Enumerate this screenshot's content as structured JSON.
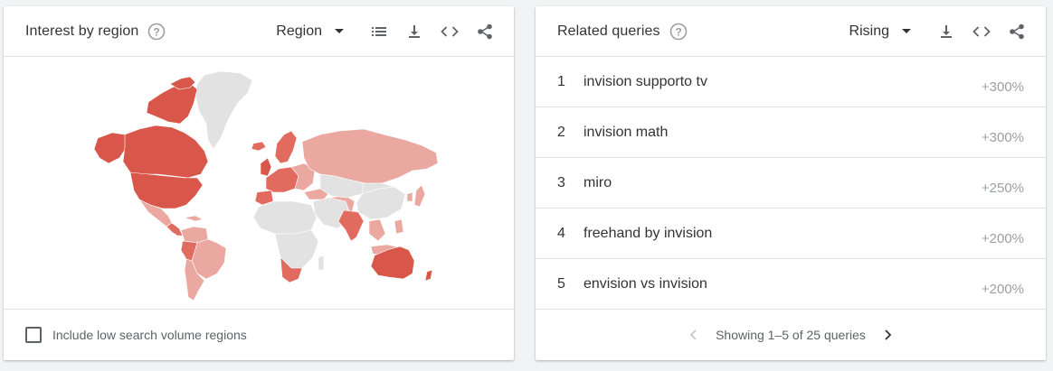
{
  "interest_card": {
    "title": "Interest by region",
    "help_icon": "help-circle-icon",
    "select_label": "Region",
    "tools": [
      "list-icon",
      "download-icon",
      "embed-code-icon",
      "share-icon"
    ],
    "checkbox_label": "Include low search volume regions",
    "checkbox_checked": false,
    "colors": {
      "high": "#d8574a",
      "medium": "#e06b5e",
      "low": "#eba8a0",
      "none": "#e2e2e2"
    }
  },
  "queries_card": {
    "title": "Related queries",
    "help_icon": "help-circle-icon",
    "select_label": "Rising",
    "tools": [
      "download-icon",
      "embed-code-icon",
      "share-icon"
    ],
    "rows": [
      {
        "index": "1",
        "query": "invision supporto tv",
        "value": "+300%"
      },
      {
        "index": "2",
        "query": "invision math",
        "value": "+300%"
      },
      {
        "index": "3",
        "query": "miro",
        "value": "+250%"
      },
      {
        "index": "4",
        "query": "freehand by invision",
        "value": "+200%"
      },
      {
        "index": "5",
        "query": "envision vs invision",
        "value": "+200%"
      }
    ],
    "pager_text": "Showing 1–5 of 25 queries"
  }
}
